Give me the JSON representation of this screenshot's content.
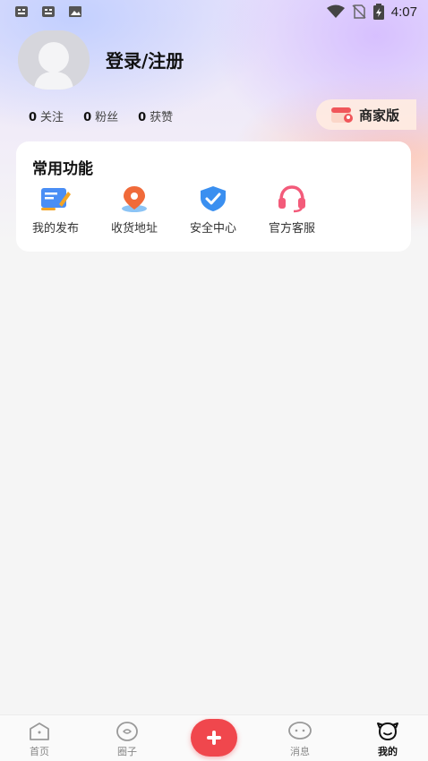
{
  "status_bar": {
    "time": "4:07",
    "left_icons": [
      "notification-icon",
      "notification-icon",
      "image-icon"
    ],
    "right_icons": [
      "wifi-icon",
      "no-sim-icon",
      "battery-icon"
    ]
  },
  "profile": {
    "login_label": "登录/注册",
    "stats": [
      {
        "count": "0",
        "label": "关注"
      },
      {
        "count": "0",
        "label": "粉丝"
      },
      {
        "count": "0",
        "label": "获赞"
      }
    ],
    "merchant_label": "商家版"
  },
  "functions": {
    "title": "常用功能",
    "items": [
      {
        "label": "我的发布",
        "icon": "edit-document-icon"
      },
      {
        "label": "收货地址",
        "icon": "location-pin-icon"
      },
      {
        "label": "安全中心",
        "icon": "shield-check-icon"
      },
      {
        "label": "官方客服",
        "icon": "headset-icon"
      }
    ]
  },
  "bottom_nav": {
    "items": [
      {
        "label": "首页",
        "icon": "home-icon"
      },
      {
        "label": "圈子",
        "icon": "circle-icon"
      },
      {
        "label": "",
        "icon": "plus-icon"
      },
      {
        "label": "消息",
        "icon": "message-icon"
      },
      {
        "label": "我的",
        "icon": "profile-icon",
        "active": true
      }
    ]
  },
  "colors": {
    "accent": "#f0474d",
    "shield": "#3a8ff0",
    "headset": "#f35b7a",
    "pin": "#f06a3a"
  }
}
